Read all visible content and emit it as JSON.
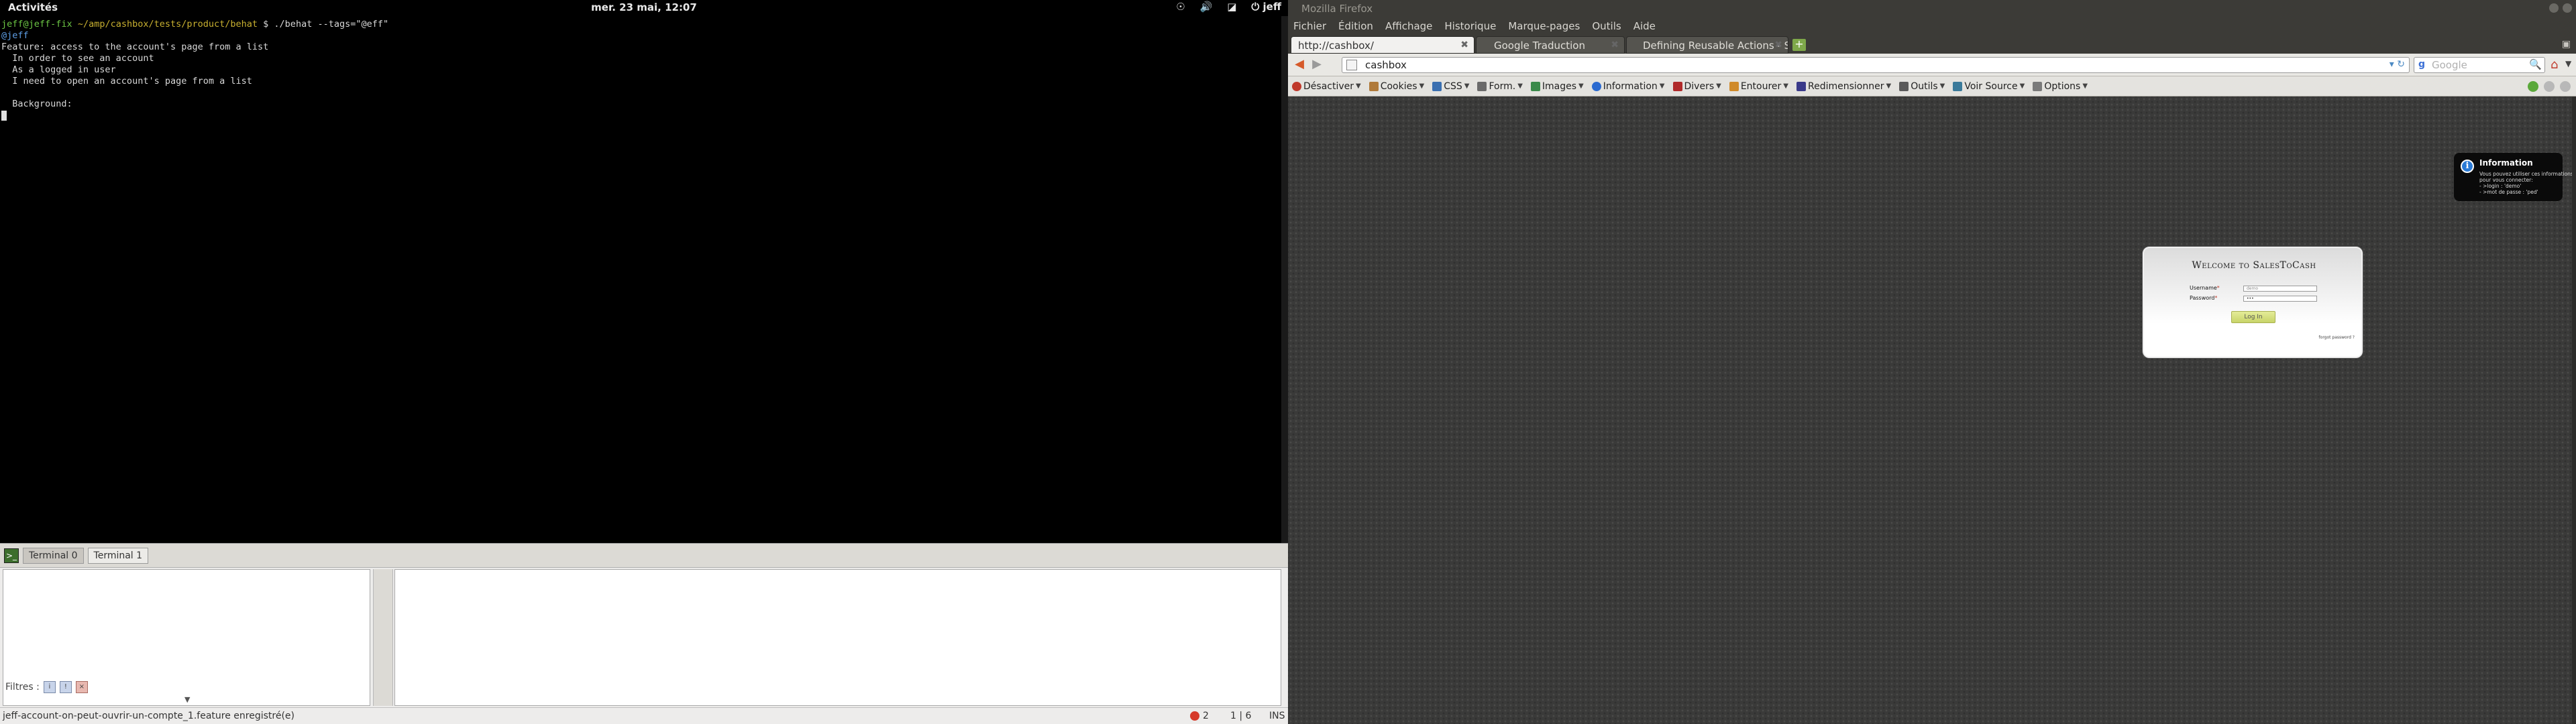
{
  "top_panel": {
    "activities": "Activités",
    "clock": "mer. 23 mai, 12:07",
    "user": "jeff",
    "icons": [
      "accessibility-icon",
      "volume-icon",
      "network-icon",
      "power-icon"
    ]
  },
  "terminal": {
    "prompt_user": "jeff@jeff-fix",
    "prompt_path": "~/amp/cashbox/tests/product/behat",
    "command": "$ ./behat --tags=\"@eff\"",
    "tag_line": "@jeff",
    "lines": [
      "Feature: access to the account's page from a list",
      "  In order to see an account",
      "  As a logged in user",
      "  I need to open an account's page from a list",
      "",
      "  Background:"
    ]
  },
  "editor": {
    "tabs": [
      "Terminal 0",
      "Terminal 1"
    ],
    "filter_label": "Filtres :",
    "status_message": "jeff-account-on-peut-ouvrir-un-compte_1.feature enregistré(e)",
    "error_count": "2",
    "cursor_position": "1 | 6",
    "insert_mode": "INS"
  },
  "firefox": {
    "window_title": "Mozilla Firefox",
    "menu": [
      "Fichier",
      "Édition",
      "Affichage",
      "Historique",
      "Marque-pages",
      "Outils",
      "Aide"
    ],
    "tabs": [
      {
        "label": "http://cashbox/",
        "active": true
      },
      {
        "label": "Google Traduction",
        "active": false
      },
      {
        "label": "Defining Reusable Actions - S...",
        "active": false
      }
    ],
    "url": "cashbox",
    "search_placeholder": "Google",
    "devbar": [
      {
        "label": "Désactiver",
        "icon": "disable-icon",
        "color": "#c0392b"
      },
      {
        "label": "Cookies",
        "icon": "cookie-icon",
        "color": "#b07a3a"
      },
      {
        "label": "CSS",
        "icon": "css-icon",
        "color": "#3a6fb0"
      },
      {
        "label": "Form.",
        "icon": "form-icon",
        "color": "#6a6a6a"
      },
      {
        "label": "Images",
        "icon": "images-icon",
        "color": "#3a8a4a"
      },
      {
        "label": "Information",
        "icon": "information-icon",
        "color": "#2a6ad0"
      },
      {
        "label": "Divers",
        "icon": "misc-icon",
        "color": "#b02a2a"
      },
      {
        "label": "Entourer",
        "icon": "outline-icon",
        "color": "#d08a2a"
      },
      {
        "label": "Redimensionner",
        "icon": "resize-icon",
        "color": "#3a3a8a"
      },
      {
        "label": "Outils",
        "icon": "tools-icon",
        "color": "#5a5a5a"
      },
      {
        "label": "Voir Source",
        "icon": "view-source-icon",
        "color": "#3a7a9a"
      },
      {
        "label": "Options",
        "icon": "options-icon",
        "color": "#7a7a7a"
      }
    ]
  },
  "page": {
    "info": {
      "title": "Information",
      "lines": [
        "Vous pouvez utiliser ces informations",
        "pour vous connecter:",
        "",
        "- >login : 'demo'",
        "- >mot de passe : 'ped'"
      ]
    },
    "login": {
      "title": "Welcome to SalesToCash",
      "username_label": "Username",
      "password_label": "Password",
      "required_mark": "*",
      "username_value": "demo",
      "password_value": "•••",
      "button": "Log In",
      "forgot": "forgot password ?"
    }
  }
}
